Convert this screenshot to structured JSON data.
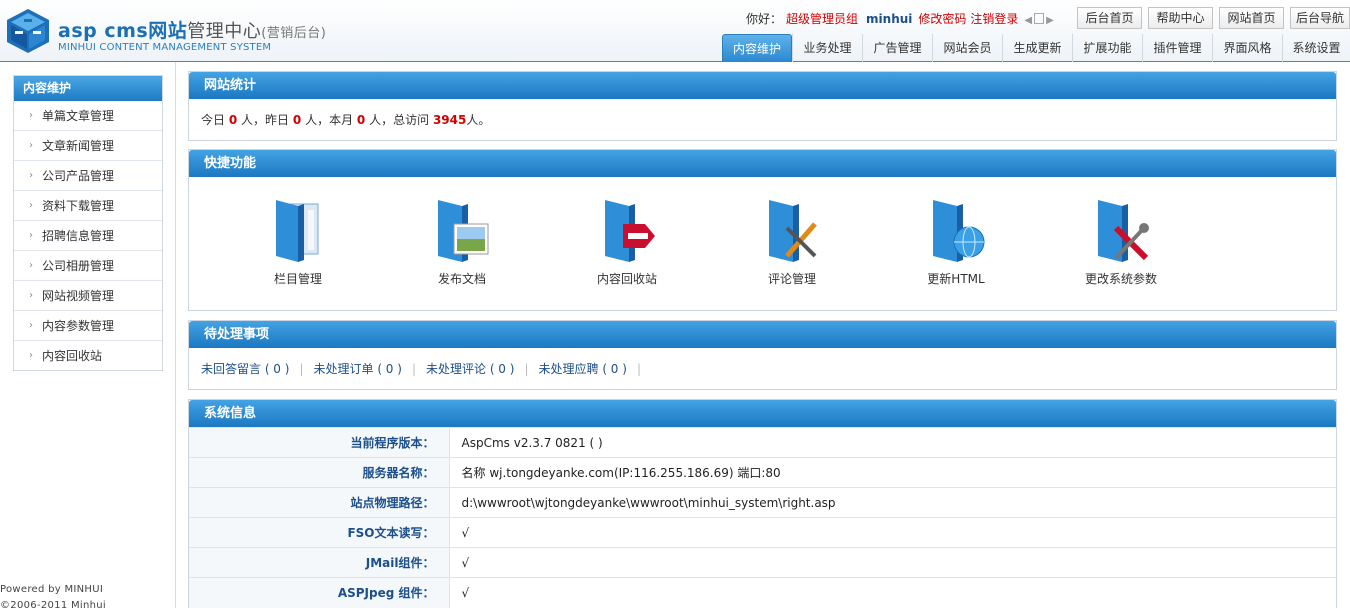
{
  "header": {
    "title_main": "asp cms网站",
    "title_sub": "管理中心",
    "title_paren": "(营销后台)",
    "subtitle": "MINHUI CONTENT MANAGEMENT SYSTEM",
    "greeting": "你好：",
    "user_group": "超级管理员组",
    "username": "minhui",
    "change_password": "修改密码",
    "logout": "注销登录",
    "top_buttons": [
      "后台首页",
      "帮助中心",
      "网站首页",
      "后台导航"
    ]
  },
  "nav": {
    "tabs": [
      "内容维护",
      "业务处理",
      "广告管理",
      "网站会员",
      "生成更新",
      "扩展功能",
      "插件管理",
      "界面风格",
      "系统设置"
    ]
  },
  "sidebar": {
    "title": "内容维护",
    "items": [
      "单篇文章管理",
      "文章新闻管理",
      "公司产品管理",
      "资料下载管理",
      "招聘信息管理",
      "公司相册管理",
      "网站视频管理",
      "内容参数管理",
      "内容回收站"
    ]
  },
  "footer": {
    "line1": "Powered by MINHUI",
    "line2": "©2006-2011 Minhui"
  },
  "stats": {
    "heading": "网站统计",
    "t1": "今日",
    "today": "0",
    "t2": "人，昨日",
    "yesterday": "0",
    "t3": "人，本月",
    "month": "0",
    "t4": "人，总访问",
    "total": "3945",
    "t5": "人。"
  },
  "quick": {
    "heading": "快捷功能",
    "items": [
      {
        "label": "栏目管理",
        "icon": "folder-book-icon"
      },
      {
        "label": "发布文档",
        "icon": "folder-image-icon"
      },
      {
        "label": "内容回收站",
        "icon": "folder-delete-icon"
      },
      {
        "label": "评论管理",
        "icon": "folder-pen-icon"
      },
      {
        "label": "更新HTML",
        "icon": "folder-globe-icon"
      },
      {
        "label": "更改系统参数",
        "icon": "folder-tools-icon"
      }
    ]
  },
  "pending": {
    "heading": "待处理事项",
    "items": [
      "未回答留言 ( 0 )",
      "未处理订单 ( 0 )",
      "未处理评论 ( 0 )",
      "未处理应聘 ( 0 )"
    ]
  },
  "sysinfo": {
    "heading": "系统信息",
    "rows": [
      {
        "key": "当前程序版本：",
        "value": "AspCms v2.3.7 0821 ( )"
      },
      {
        "key": "服务器名称：",
        "value": "名称 wj.tongdeyanke.com(IP:116.255.186.69) 端口:80"
      },
      {
        "key": "站点物理路径：",
        "value": "d:\\wwwroot\\wjtongdeyanke\\wwwroot\\minhui_system\\right.asp"
      },
      {
        "key": "FSO文本读写：",
        "value": "√"
      },
      {
        "key": "JMail组件：",
        "value": "√"
      },
      {
        "key": "ASPJpeg 组件：",
        "value": "√"
      }
    ]
  },
  "colors": {
    "accent": "#1b78c2",
    "highlight": "#d40000"
  }
}
